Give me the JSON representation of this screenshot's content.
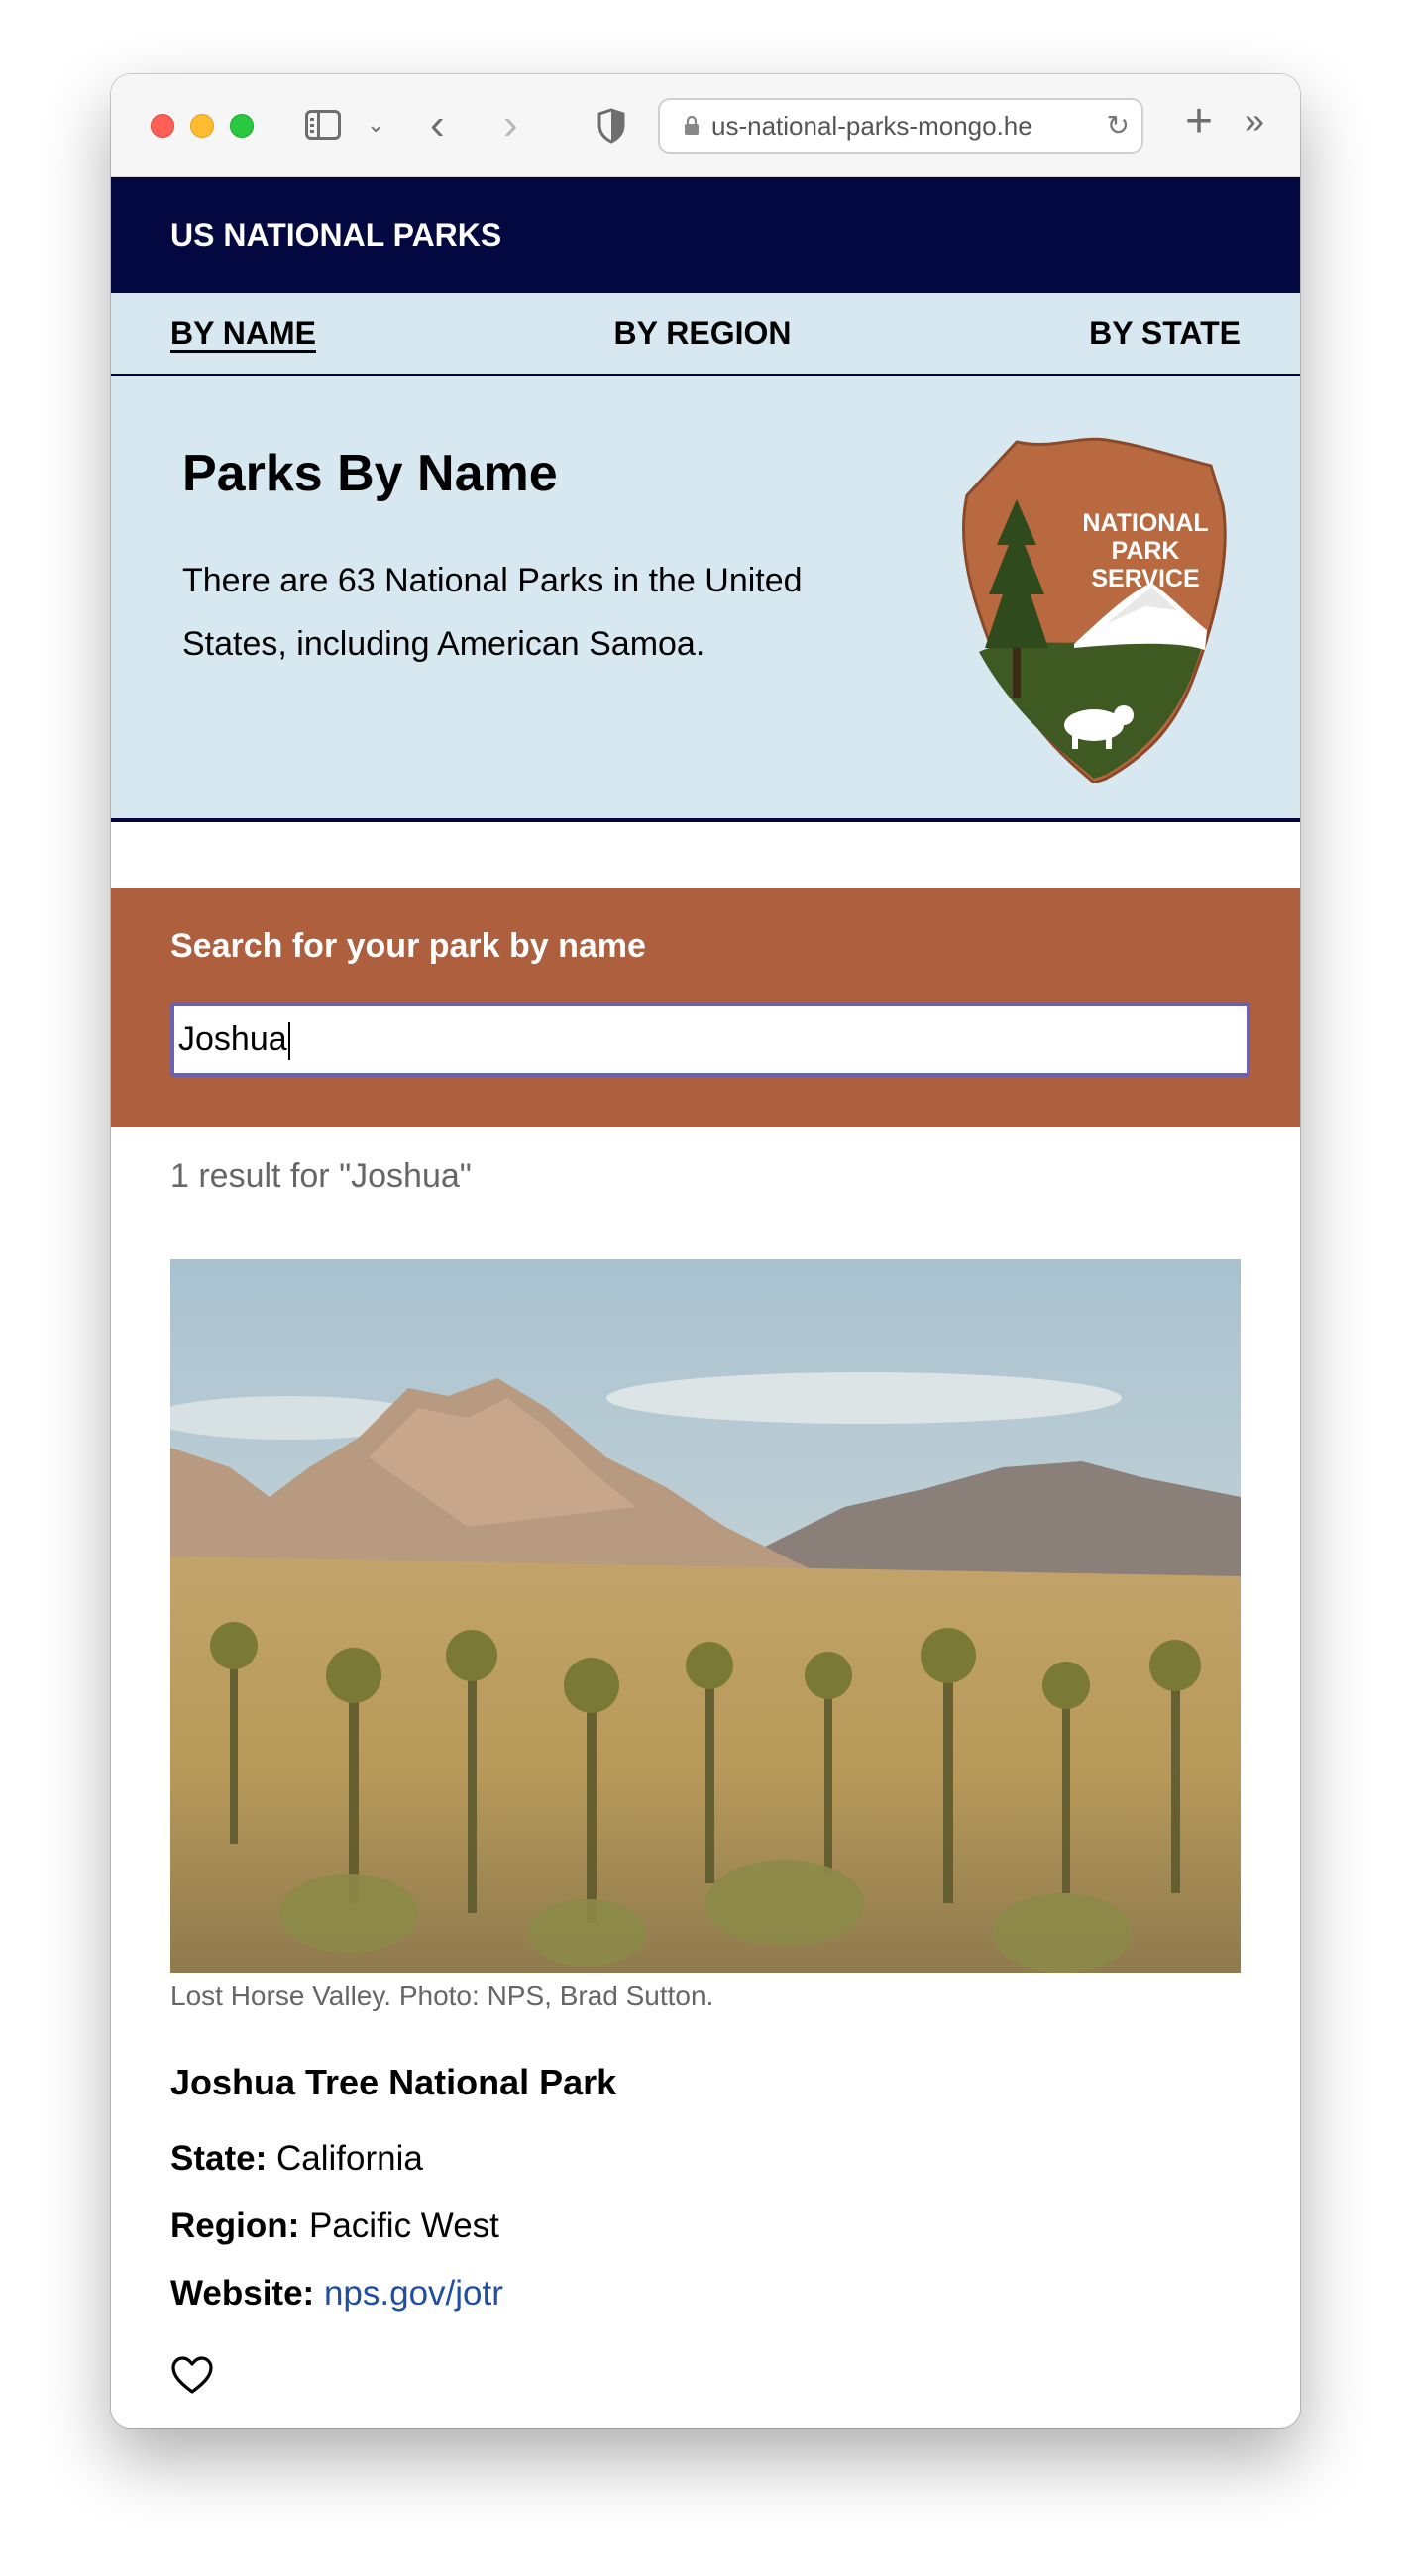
{
  "browser": {
    "url": "us-national-parks-mongo.he"
  },
  "site": {
    "title": "US NATIONAL PARKS"
  },
  "nav": {
    "items": [
      {
        "label": "BY NAME",
        "active": true
      },
      {
        "label": "BY REGION",
        "active": false
      },
      {
        "label": "BY STATE",
        "active": false
      }
    ]
  },
  "hero": {
    "heading": "Parks By Name",
    "description": "There are 63 National Parks in the United States, including American Samoa.",
    "badge_line1": "NATIONAL",
    "badge_line2": "PARK",
    "badge_line3": "SERVICE"
  },
  "search": {
    "label": "Search for your park by name",
    "value": "Joshua"
  },
  "results": {
    "summary": "1 result for \"Joshua\""
  },
  "park": {
    "caption": "Lost Horse Valley. Photo: NPS, Brad Sutton.",
    "name": "Joshua Tree National Park",
    "state_label": "State:",
    "state": "California",
    "region_label": "Region:",
    "region": "Pacific West",
    "website_label": "Website:",
    "website": "nps.gov/jotr"
  },
  "colors": {
    "header_bg": "#030940",
    "nav_bg": "#d8e8f1",
    "search_bg": "#ad5f3e",
    "link": "#1f4fa3"
  }
}
